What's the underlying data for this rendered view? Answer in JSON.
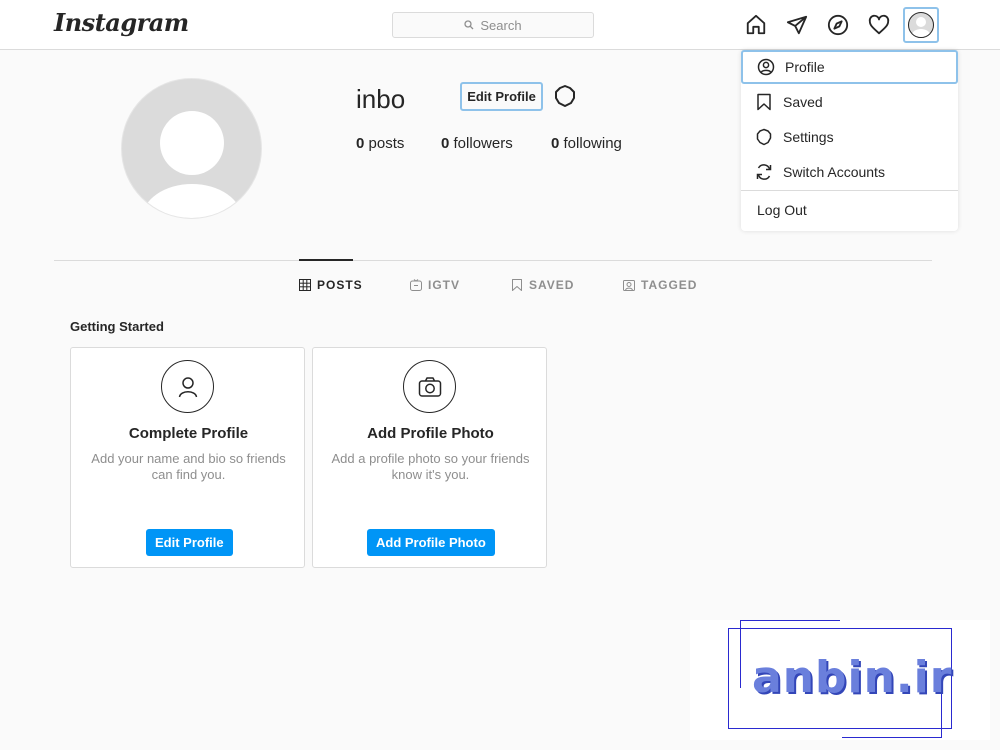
{
  "nav": {
    "logo": "Instagram",
    "search_placeholder": "Search",
    "icons": [
      "home-icon",
      "direct-icon",
      "explore-icon",
      "activity-icon",
      "avatar"
    ]
  },
  "dropdown": {
    "items": [
      {
        "label": "Profile",
        "icon": "profile-icon",
        "active": true
      },
      {
        "label": "Saved",
        "icon": "bookmark-icon"
      },
      {
        "label": "Settings",
        "icon": "gear-icon"
      },
      {
        "label": "Switch Accounts",
        "icon": "switch-icon"
      }
    ],
    "logout": "Log Out"
  },
  "profile": {
    "username": "inbo",
    "edit_button": "Edit Profile",
    "stats": [
      {
        "count": "0",
        "label": "posts"
      },
      {
        "count": "0",
        "label": "followers"
      },
      {
        "count": "0",
        "label": "following"
      }
    ]
  },
  "tabs": [
    {
      "label": "POSTS",
      "icon": "grid-icon",
      "active": true
    },
    {
      "label": "IGTV",
      "icon": "igtv-icon"
    },
    {
      "label": "SAVED",
      "icon": "bookmark-icon"
    },
    {
      "label": "TAGGED",
      "icon": "tag-icon"
    }
  ],
  "getting_started": {
    "title": "Getting Started",
    "cards": [
      {
        "title": "Complete Profile",
        "description": "Add your name and bio so friends can find you.",
        "button": "Edit Profile",
        "icon": "person-icon"
      },
      {
        "title": "Add Profile Photo",
        "description": "Add a profile photo so your friends know it's you.",
        "button": "Add Profile Photo",
        "icon": "camera-icon"
      }
    ]
  },
  "watermark": "anbin.ir",
  "colors": {
    "accent": "#0095f6",
    "focus_outline": "#8ec2ea",
    "text": "#262626",
    "muted": "#8e8e8e",
    "border": "#dbdbdb",
    "watermark": "#6a7fdc"
  }
}
